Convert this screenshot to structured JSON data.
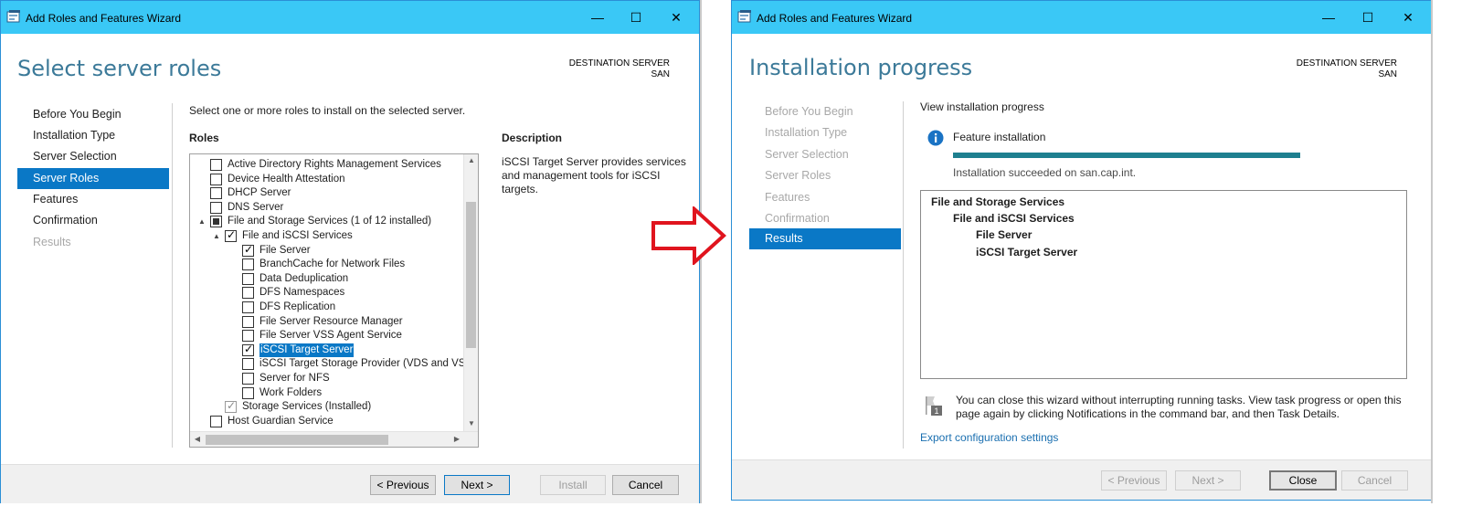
{
  "left_window": {
    "titlebar": {
      "title": "Add Roles and Features Wizard",
      "minimize": "—",
      "maximize": "☐",
      "close": "✕"
    },
    "page_title": "Select server roles",
    "destination": {
      "label": "DESTINATION SERVER",
      "server": "SAN"
    },
    "nav": [
      {
        "label": "Before You Begin",
        "state": "normal"
      },
      {
        "label": "Installation Type",
        "state": "normal"
      },
      {
        "label": "Server Selection",
        "state": "normal"
      },
      {
        "label": "Server Roles",
        "state": "selected"
      },
      {
        "label": "Features",
        "state": "normal"
      },
      {
        "label": "Confirmation",
        "state": "normal"
      },
      {
        "label": "Results",
        "state": "disabled"
      }
    ],
    "instruction": "Select one or more roles to install on the selected server.",
    "roles_heading": "Roles",
    "description_heading": "Description",
    "description_text": [
      "iSCSI Target Server provides services",
      "and management tools for iSCSI",
      "targets."
    ],
    "roles": [
      {
        "label": "Active Directory Rights Management Services",
        "check": "none",
        "level": 0,
        "expander": ""
      },
      {
        "label": "Device Health Attestation",
        "check": "none",
        "level": 0,
        "expander": ""
      },
      {
        "label": "DHCP Server",
        "check": "none",
        "level": 0,
        "expander": ""
      },
      {
        "label": "DNS Server",
        "check": "none",
        "level": 0,
        "expander": ""
      },
      {
        "label": "File and Storage Services (1 of 12 installed)",
        "check": "partial",
        "level": 0,
        "expander": "▲"
      },
      {
        "label": "File and iSCSI Services",
        "check": "checked",
        "level": 1,
        "expander": "▲"
      },
      {
        "label": "File Server",
        "check": "checked",
        "level": 2,
        "expander": ""
      },
      {
        "label": "BranchCache for Network Files",
        "check": "none",
        "level": 2,
        "expander": ""
      },
      {
        "label": "Data Deduplication",
        "check": "none",
        "level": 2,
        "expander": ""
      },
      {
        "label": "DFS Namespaces",
        "check": "none",
        "level": 2,
        "expander": ""
      },
      {
        "label": "DFS Replication",
        "check": "none",
        "level": 2,
        "expander": ""
      },
      {
        "label": "File Server Resource Manager",
        "check": "none",
        "level": 2,
        "expander": ""
      },
      {
        "label": "File Server VSS Agent Service",
        "check": "none",
        "level": 2,
        "expander": ""
      },
      {
        "label": "iSCSI Target Server",
        "check": "checked",
        "level": 2,
        "expander": "",
        "highlight": true
      },
      {
        "label": "iSCSI Target Storage Provider (VDS and VSS",
        "check": "none",
        "level": 2,
        "expander": ""
      },
      {
        "label": "Server for NFS",
        "check": "none",
        "level": 2,
        "expander": ""
      },
      {
        "label": "Work Folders",
        "check": "none",
        "level": 2,
        "expander": ""
      },
      {
        "label": "Storage Services (Installed)",
        "check": "grey",
        "level": 1,
        "expander": ""
      },
      {
        "label": "Host Guardian Service",
        "check": "none",
        "level": 0,
        "expander": ""
      }
    ],
    "scroll": {
      "up": "▲",
      "down": "▼",
      "left": "◀",
      "right": "▶"
    },
    "buttons": {
      "previous": "< Previous",
      "next": "Next >",
      "install": "Install",
      "cancel": "Cancel"
    }
  },
  "right_window": {
    "titlebar": {
      "title": "Add Roles and Features Wizard",
      "minimize": "—",
      "maximize": "☐",
      "close": "✕"
    },
    "page_title": "Installation progress",
    "destination": {
      "label": "DESTINATION SERVER",
      "server": "SAN"
    },
    "nav": [
      {
        "label": "Before You Begin",
        "state": "disabled"
      },
      {
        "label": "Installation Type",
        "state": "disabled"
      },
      {
        "label": "Server Selection",
        "state": "disabled"
      },
      {
        "label": "Server Roles",
        "state": "disabled"
      },
      {
        "label": "Features",
        "state": "disabled"
      },
      {
        "label": "Confirmation",
        "state": "disabled"
      },
      {
        "label": "Results",
        "state": "selected"
      }
    ],
    "view_progress": "View installation progress",
    "feature_installation": "Feature installation",
    "progress": 1.0,
    "status": "Installation succeeded on san.cap.int.",
    "results": [
      {
        "label": "File and Storage Services",
        "level": 0
      },
      {
        "label": "File and iSCSI Services",
        "level": 1
      },
      {
        "label": "File Server",
        "level": 2
      },
      {
        "label": "iSCSI Target Server",
        "level": 2
      }
    ],
    "note_lines": [
      "You can close this wizard without interrupting running tasks. View task progress or open this",
      "page again by clicking Notifications in the command bar, and then Task Details."
    ],
    "note_badge": "1",
    "export_link": "Export configuration settings",
    "buttons": {
      "previous": "< Previous",
      "next": "Next >",
      "close": "Close",
      "cancel": "Cancel"
    }
  },
  "colors": {
    "titlebar": "#3ac8f6",
    "accent": "#0a78c6",
    "heading": "#3c7a99",
    "arrow": "#e0141e",
    "progress": "#1e7f8f"
  }
}
